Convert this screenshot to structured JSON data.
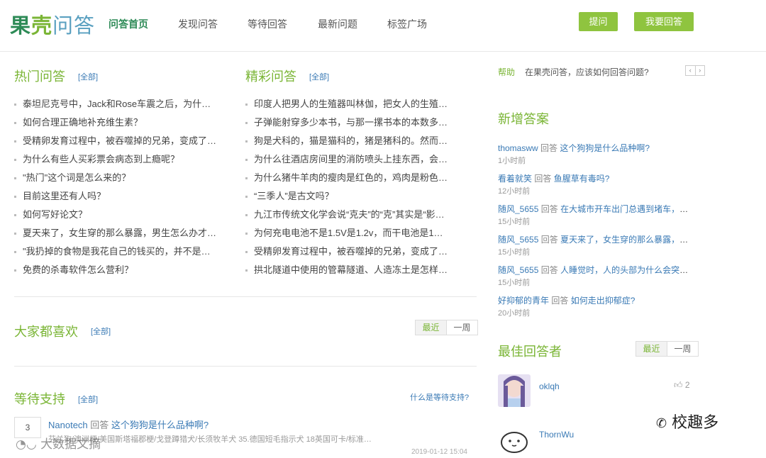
{
  "header": {
    "logo_part1": "果",
    "logo_part2": "壳",
    "logo_part3": "问答",
    "nav": [
      "问答首页",
      "发现问答",
      "等待回答",
      "最新问题",
      "标签广场"
    ],
    "ask_button": "提问",
    "answer_button": "我要回答"
  },
  "hot": {
    "title": "热门问答",
    "all": "[全部]",
    "items": [
      "泰坦尼克号中，Jack和Rose车震之后，为什…",
      "如何合理正确地补充维生素？",
      "受精卵发育过程中，被吞噬掉的兄弟，变成了…",
      "为什么有些人买彩票会病态到上瘾呢？",
      "\"热门\"这个词是怎么来的？",
      "目前这里还有人吗？",
      "如何写好论文？",
      "夏天来了，女生穿的那么暴露，男生怎么办才…",
      "\"我扔掉的食物是我花自己的钱买的，并不是…",
      "免费的杀毒软件怎么营利？"
    ]
  },
  "featured": {
    "title": "精彩问答",
    "all": "[全部]",
    "items": [
      "印度人把男人的生殖器叫林伽，把女人的生殖…",
      "子弹能射穿多少本书，与那一摞书本的本数多…",
      "狗是犬科的，猫是猫科的，猪是猪科的。然而…",
      "为什么往酒店房间里的消防喷头上挂东西，会…",
      "为什么猪牛羊肉的瘦肉是红色的，鸡肉是粉色…",
      "“三季人”是古文吗？",
      "九江市传统文化学会说“克夫”的“克”其实是“影…",
      "为何充电电池不是1.5V是1.2v，而干电池是1…",
      "受精卵发育过程中，被吞噬掉的兄弟，变成了…",
      "拱北隧道中使用的管幕隧道、人造冻土是怎样…"
    ]
  },
  "liked": {
    "title": "大家都喜欢",
    "all": "[全部]",
    "tab_recent": "最近",
    "tab_week": "一周"
  },
  "support": {
    "title": "等待支持",
    "all": "[全部]",
    "what": "什么是等待支持?",
    "votes": "3",
    "user": "Nanotech",
    "verb": "回答",
    "question": "这个狗狗是什么品种啊?",
    "excerpt": "芬兰狗/澳洲梗/美国斯塔福郡梗/戈登蹲猎犬/长须牧羊犬 35.德国短毛指示犬 18英国可卡/标准…",
    "time": "2019-01-12 15:04"
  },
  "help": {
    "label": "帮助",
    "text": "在果壳问答，应该如何回答问题?",
    "prev": "‹",
    "next": "›"
  },
  "new_answers": {
    "title": "新增答案",
    "items": [
      {
        "user": "thomasww",
        "verb": "回答",
        "question": "这个狗狗是什么品种啊?",
        "time": "1小时前"
      },
      {
        "user": "看着就笑",
        "verb": "回答",
        "question": "鱼腥草有毒吗?",
        "time": "12小时前"
      },
      {
        "user": "随风_5655",
        "verb": "回答",
        "question": "在大城市开车出门总遇到堵车，交…",
        "time": "15小时前"
      },
      {
        "user": "随风_5655",
        "verb": "回答",
        "question": "夏天来了，女生穿的那么暴露，男…",
        "time": "15小时前"
      },
      {
        "user": "随风_5655",
        "verb": "回答",
        "question": "人睡觉时，人的头部为什么会突然…",
        "time": "15小时前"
      },
      {
        "user": "好抑郁的青年",
        "verb": "回答",
        "question": "如何走出抑郁症?",
        "time": "20小时前"
      }
    ]
  },
  "best_answerers": {
    "title": "最佳回答者",
    "tab_recent": "最近",
    "tab_week": "一周",
    "items": [
      {
        "name": "oklqh",
        "count": "2"
      },
      {
        "name": "ThornWu",
        "count": ""
      }
    ]
  },
  "watermark_left": "大数据文摘",
  "watermark_right": "校趣多",
  "colors": {
    "accent_green": "#7ab535",
    "button_green": "#8fc43f",
    "link_blue": "#3a7ab5"
  }
}
